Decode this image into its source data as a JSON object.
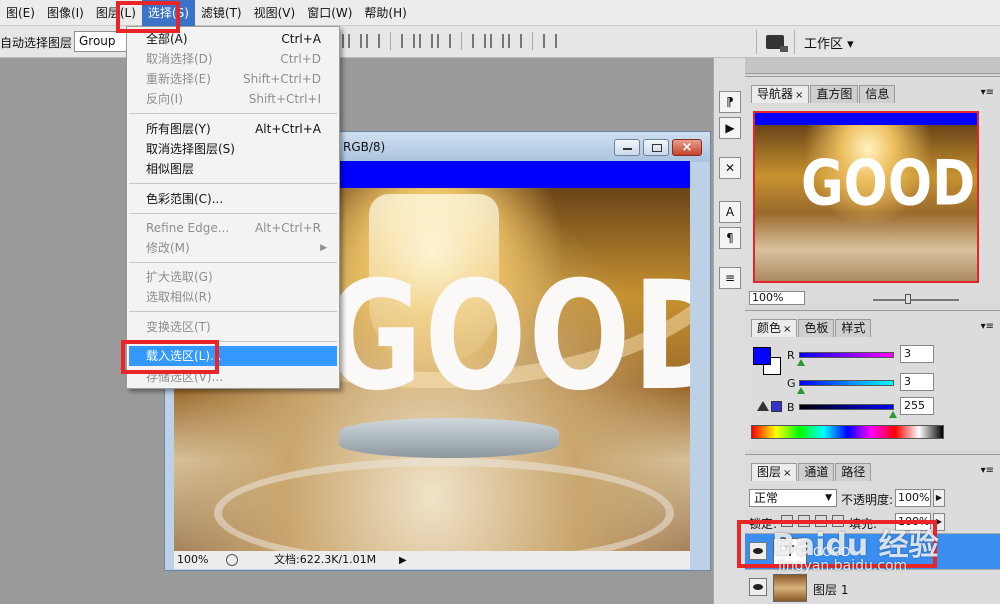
{
  "menubar": {
    "items": [
      "图(E)",
      "图像(I)",
      "图层(L)",
      "选择(S)",
      "滤镜(T)",
      "视图(V)",
      "窗口(W)",
      "帮助(H)"
    ]
  },
  "options": {
    "auto_select_label": "自动选择图层",
    "group_value": "Group",
    "workspace_label": "工作区 ▾"
  },
  "document": {
    "title": "RGB/8)",
    "canvas_text": "GOOD",
    "zoom": "100%",
    "doc_size": "文档:622.3K/1.01M",
    "arrow": "▶"
  },
  "select_menu": {
    "items": [
      {
        "label": "全部(A)",
        "shortcut": "Ctrl+A",
        "disabled": false
      },
      {
        "label": "取消选择(D)",
        "shortcut": "Ctrl+D",
        "disabled": true
      },
      {
        "label": "重新选择(E)",
        "shortcut": "Shift+Ctrl+D",
        "disabled": true
      },
      {
        "label": "反向(I)",
        "shortcut": "Shift+Ctrl+I",
        "disabled": true
      },
      {
        "label": "所有图层(Y)",
        "shortcut": "Alt+Ctrl+A",
        "disabled": false
      },
      {
        "label": "取消选择图层(S)",
        "shortcut": "",
        "disabled": false
      },
      {
        "label": "相似图层",
        "shortcut": "",
        "disabled": false
      },
      {
        "label": "色彩范围(C)...",
        "shortcut": "",
        "disabled": false
      },
      {
        "label": "Refine Edge...",
        "shortcut": "Alt+Ctrl+R",
        "disabled": true
      },
      {
        "label": "修改(M)",
        "shortcut": "",
        "disabled": true,
        "submenu_arrow": "▶"
      },
      {
        "label": "扩大选取(G)",
        "shortcut": "",
        "disabled": true
      },
      {
        "label": "选取相似(R)",
        "shortcut": "",
        "disabled": true
      },
      {
        "label": "变换选区(T)",
        "shortcut": "",
        "disabled": true
      },
      {
        "label": "载入选区(L)...",
        "shortcut": "",
        "disabled": false,
        "highlighted": true
      },
      {
        "label": "存储选区(V)...",
        "shortcut": "",
        "disabled": true
      }
    ]
  },
  "navigator": {
    "tabs": [
      "导航器",
      "直方图",
      "信息"
    ],
    "close_mark": "×",
    "zoom": "100%",
    "thumb_text": "GOOD"
  },
  "color_panel": {
    "tabs": [
      "颜色",
      "色板",
      "样式"
    ],
    "close_mark": "×",
    "channels": [
      {
        "label": "R",
        "value": "3",
        "fraction": 0.012
      },
      {
        "label": "G",
        "value": "3",
        "fraction": 0.012
      },
      {
        "label": "B",
        "value": "255",
        "fraction": 1.0
      }
    ],
    "foreground_color": "#0303ff"
  },
  "layers_panel": {
    "tabs": [
      "图层",
      "通道",
      "路径"
    ],
    "close_mark": "×",
    "blend_mode": "正常",
    "opacity_label": "不透明度:",
    "opacity_value": "100%",
    "lock_label": "锁定:",
    "fill_label": "填充:",
    "fill_value": "100%",
    "layers": [
      {
        "name": "GOOD",
        "thumb": "T",
        "selected": true
      },
      {
        "name": "图层 1",
        "thumb": "",
        "selected": false
      }
    ]
  },
  "watermark": {
    "main": "Baidu 经验",
    "url": "jingyan.baidu.com"
  },
  "accent_colors": {
    "annotation_red": "#e8262a",
    "menu_highlight": "#3399ff",
    "canvas_blue": "#0000ff"
  }
}
